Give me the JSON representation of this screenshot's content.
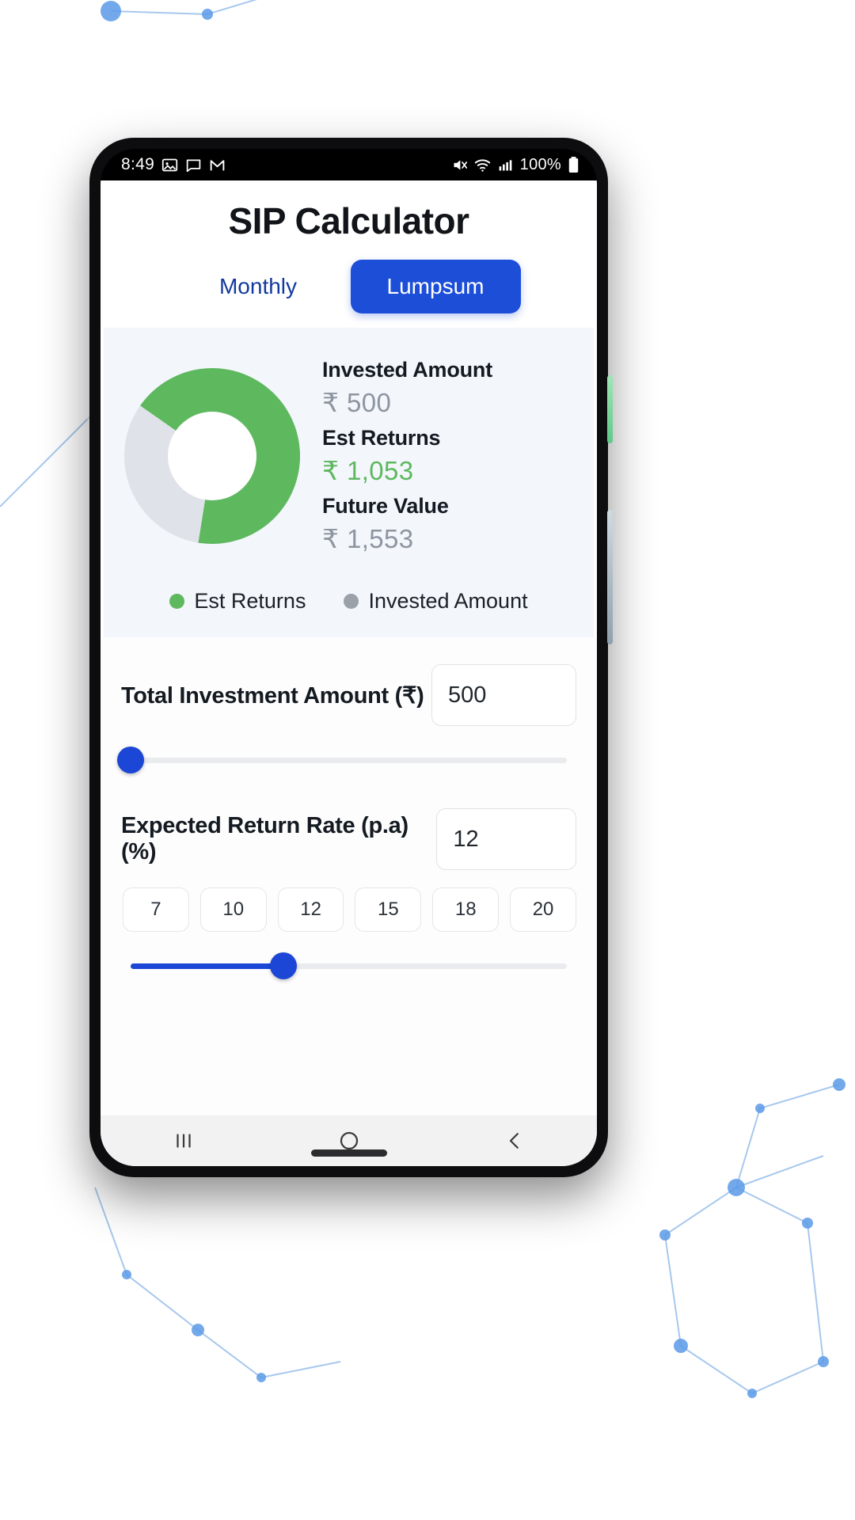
{
  "wallpaper": {
    "accent": "#0a49a6",
    "deep": "#04307a"
  },
  "statusbar": {
    "time": "8:49",
    "left_icons": [
      "image-icon",
      "chat-icon",
      "gmail-icon"
    ],
    "right_icons": [
      "mute-icon",
      "wifi-icon",
      "signal-icon"
    ],
    "battery_text": "100%"
  },
  "app": {
    "title": "SIP Calculator",
    "tabs": [
      {
        "label": "Monthly",
        "active": false
      },
      {
        "label": "Lumpsum",
        "active": true
      }
    ],
    "result": {
      "rows": [
        {
          "label": "Invested Amount",
          "value": "₹ 500",
          "color": "#8d95a0"
        },
        {
          "label": "Est Returns",
          "value": "₹ 1,053",
          "color": "#5db85e"
        },
        {
          "label": "Future Value",
          "value": "₹ 1,553",
          "color": "#8d95a0"
        }
      ],
      "legend": [
        {
          "label": "Est Returns",
          "color": "#5db85e"
        },
        {
          "label": "Invested Amount",
          "color": "#9aa1a9"
        }
      ]
    },
    "fields": [
      {
        "label": "Total Investment Amount (₹)",
        "value": "500",
        "slider_percent": 0
      },
      {
        "label": "Expected Return Rate (p.a) (%)",
        "value": "12",
        "slider_percent": 35
      }
    ],
    "rate_chips": [
      "7",
      "10",
      "12",
      "15",
      "18",
      "20"
    ],
    "colors": {
      "primary": "#1d4ed8",
      "slider": "#1b46d6",
      "green": "#5db85e",
      "grey": "#dfe2e8",
      "card_bg": "#f3f6fb"
    }
  },
  "chart_data": {
    "type": "pie",
    "title": "",
    "categories": [
      "Est Returns",
      "Invested Amount"
    ],
    "values": [
      1053,
      500
    ],
    "percent": [
      67.8,
      32.2
    ],
    "colors": [
      "#5db85e",
      "#dfe2e8"
    ],
    "legend_position": "bottom",
    "donut": true
  },
  "navbar": {
    "items": [
      "recents-icon",
      "home-icon",
      "back-icon"
    ]
  }
}
